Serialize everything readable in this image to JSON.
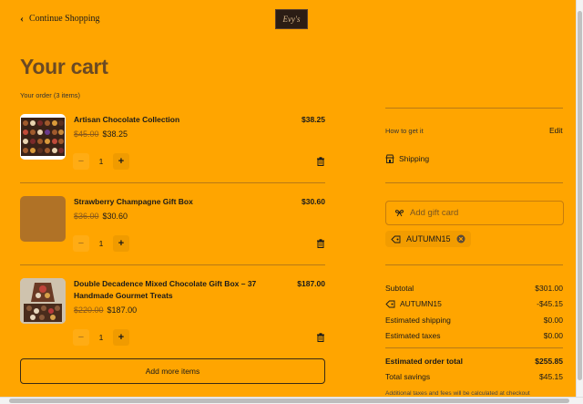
{
  "header": {
    "continue_label": "Continue Shopping",
    "logo_text": "Evy's"
  },
  "cart": {
    "title": "Your cart",
    "order_count": "Your order (3 items)",
    "items": [
      {
        "name": "Artisan Chocolate Collection",
        "original_price": "$45.00",
        "sale_price": "$38.25",
        "total": "$38.25",
        "quantity": "1",
        "minus": "−",
        "plus": "+"
      },
      {
        "name": "Strawberry Champagne Gift Box",
        "original_price": "$36.00",
        "sale_price": "$30.60",
        "total": "$30.60",
        "quantity": "1",
        "minus": "−",
        "plus": "+"
      },
      {
        "name": "Double Decadence Mixed Chocolate Gift Box – 37 Handmade Gourmet Treats",
        "original_price": "$220.00",
        "sale_price": "$187.00",
        "total": "$187.00",
        "quantity": "1",
        "minus": "−",
        "plus": "+"
      }
    ],
    "add_more_label": "Add more items"
  },
  "sidebar": {
    "how_label": "How to get it",
    "edit_label": "Edit",
    "shipping_label": "Shipping",
    "gift_card_placeholder": "Add gift card",
    "coupon_code": "AUTUMN15",
    "summary": [
      {
        "label": "Subtotal",
        "value": "$301.00"
      },
      {
        "label": "AUTUMN15",
        "value": "-$45.15"
      },
      {
        "label": "Estimated shipping",
        "value": "$0.00"
      },
      {
        "label": "Estimated taxes",
        "value": "$0.00"
      }
    ],
    "order_total_label": "Estimated order total",
    "order_total_value": "$255.85",
    "savings_label": "Total savings",
    "savings_value": "$45.15",
    "note": "Additional taxes and fees will be calculated at checkout"
  },
  "colors": {
    "background": "#ffa500",
    "title": "#6b4a24",
    "divider": "#b87a16"
  },
  "icons": {
    "back": "chevron-left-icon",
    "trash": "trash-icon",
    "shipping": "store-icon",
    "gift": "gift-card-icon",
    "tag": "tag-icon",
    "remove": "close-circle-icon"
  }
}
